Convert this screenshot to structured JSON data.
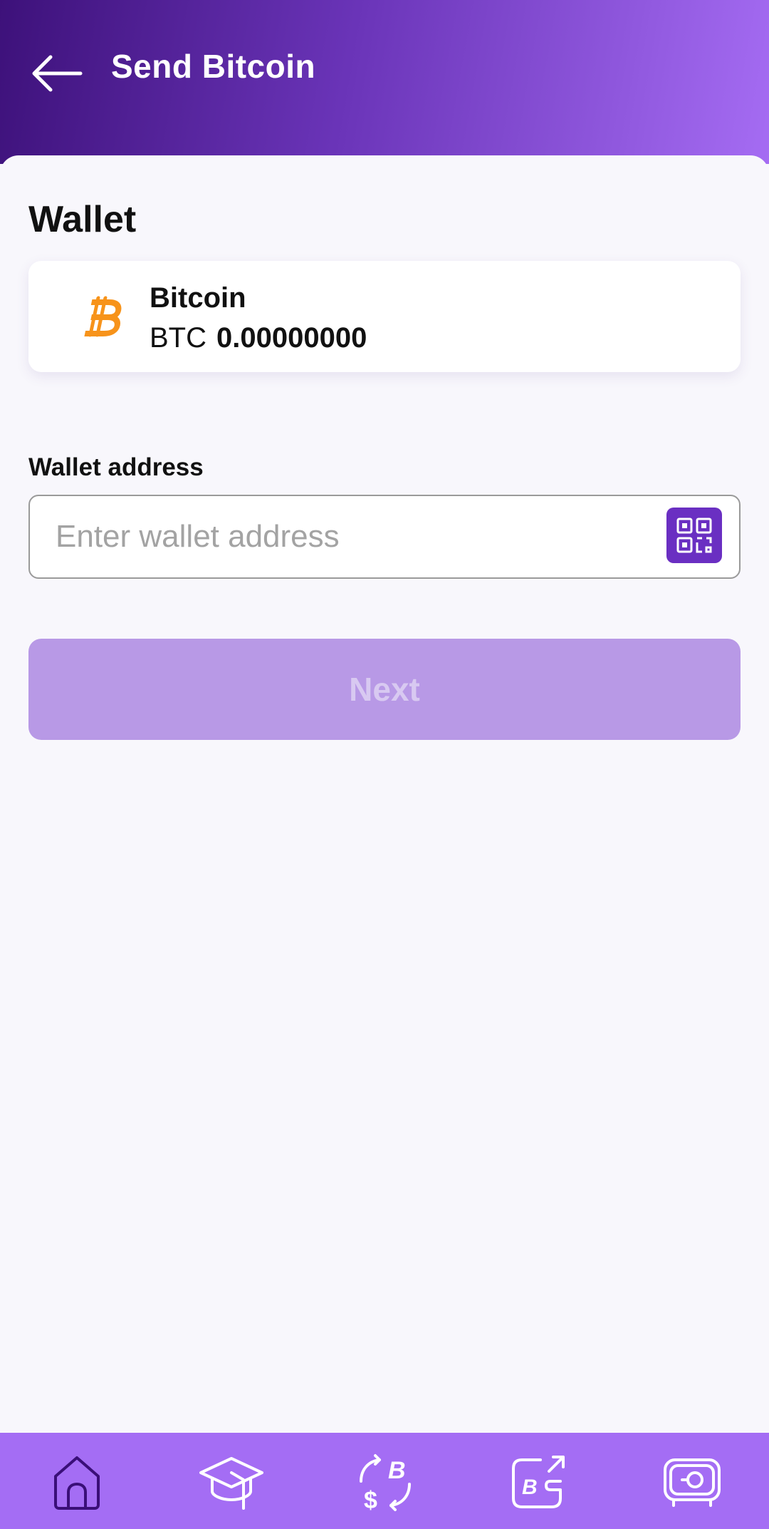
{
  "header": {
    "title": "Send Bitcoin",
    "back_icon": "arrow-left-icon"
  },
  "wallet": {
    "section_title": "Wallet",
    "coin_name": "Bitcoin",
    "coin_symbol": "BTC",
    "balance": "0.00000000",
    "coin_icon": "bitcoin-icon",
    "coin_color": "#f7931a"
  },
  "address": {
    "label": "Wallet address",
    "value": "",
    "placeholder": "Enter wallet address",
    "scan_icon": "qr-code-icon"
  },
  "next_button": {
    "label": "Next",
    "enabled": false
  },
  "bottom_nav": {
    "items": [
      {
        "icon": "home-icon",
        "active": true
      },
      {
        "icon": "graduation-cap-icon",
        "active": false
      },
      {
        "icon": "exchange-bitcoin-dollar-icon",
        "active": false
      },
      {
        "icon": "send-bitcoin-icon",
        "active": false
      },
      {
        "icon": "vault-icon",
        "active": false
      }
    ]
  },
  "colors": {
    "header_gradient_start": "#3d117a",
    "header_gradient_end": "#a56cf3",
    "accent": "#6a2fc2",
    "nav_background": "#a46df4",
    "nav_active": "#3a0f78",
    "button_disabled": "#b899e6"
  }
}
